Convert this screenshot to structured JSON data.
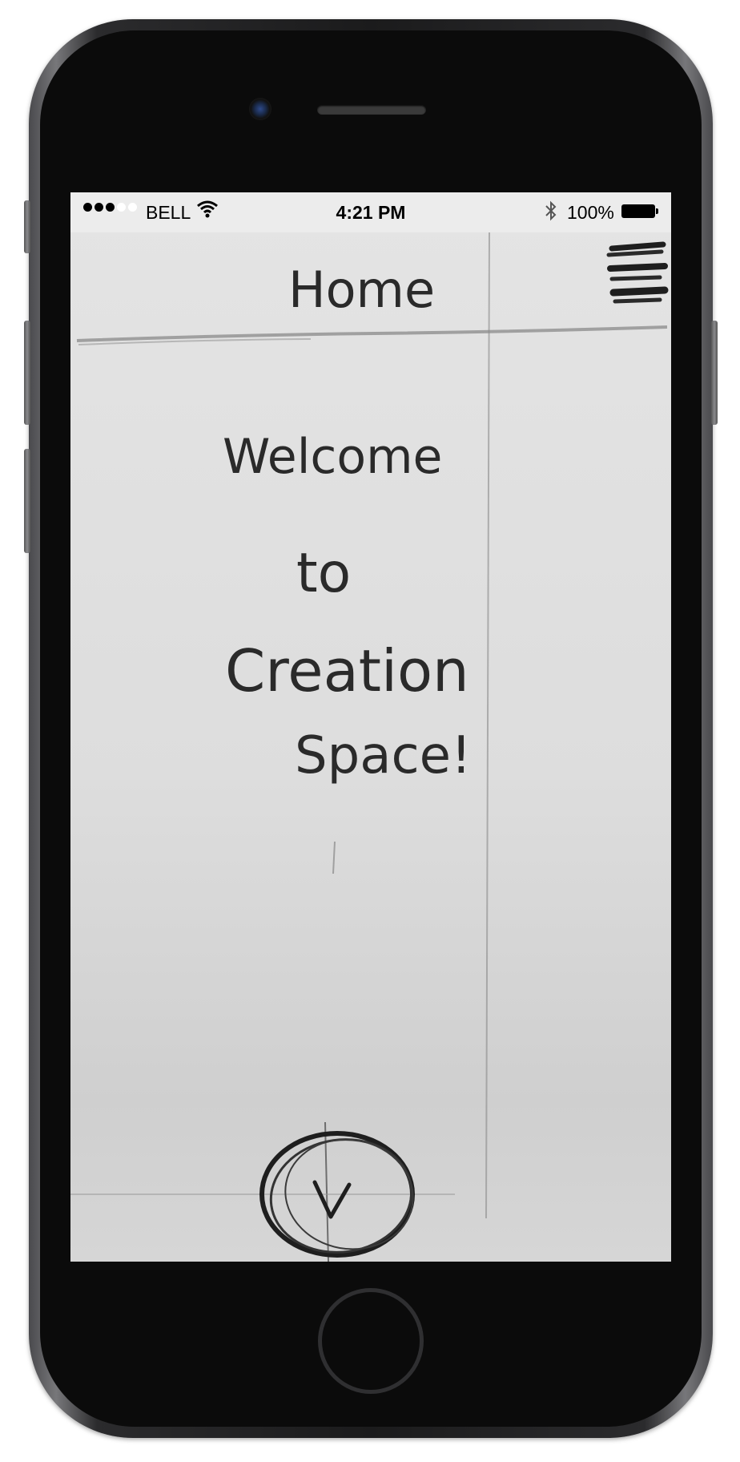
{
  "status_bar": {
    "carrier": "BELL",
    "time": "4:21 PM",
    "battery": "100%",
    "signal_icon": "signal-dots-icon",
    "wifi_icon": "wifi-icon",
    "bluetooth_icon": "bluetooth-icon",
    "battery_icon": "battery-icon"
  },
  "header": {
    "title": "Home",
    "menu_icon": "hamburger-menu-icon"
  },
  "main": {
    "welcome_line1": "Welcome",
    "welcome_line2": "to",
    "welcome_line3": "Creation",
    "welcome_line4": "Space!"
  },
  "footer": {
    "action_icon": "checkmark-circle-icon"
  },
  "colors": {
    "device": "#1b1b1c",
    "paper": "#dddddd",
    "pencil": "#2a2a2a",
    "statusbar": "#ececec"
  }
}
